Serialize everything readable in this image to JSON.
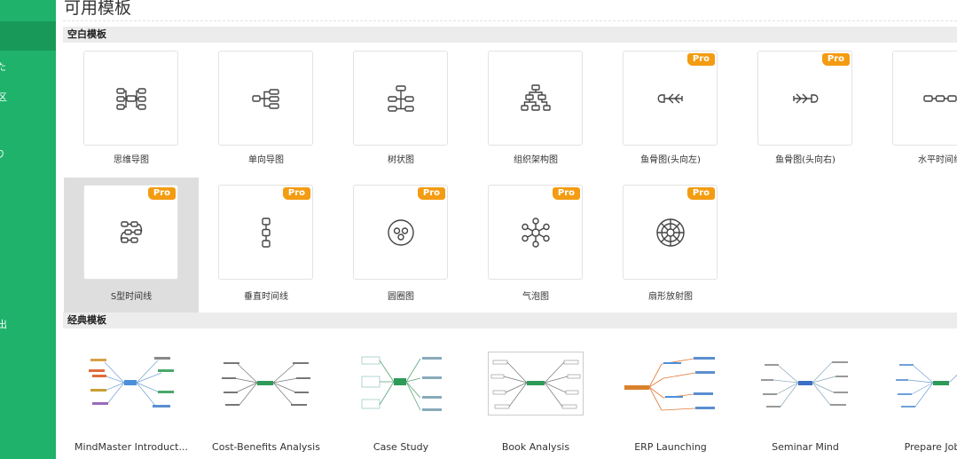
{
  "colors": {
    "sidebar": "#1fb26b",
    "sidebar_active": "#18995a",
    "pro_badge": "#f39c12",
    "selected_tile": "#dedede"
  },
  "sidebar": {
    "items": [
      "た",
      "区",
      "り",
      "出"
    ]
  },
  "page": {
    "title": "可用模板"
  },
  "sections": {
    "blank": "空白模板",
    "classic": "经典模板"
  },
  "pro_label": "Pro",
  "blank_templates": [
    {
      "label": "思维导图",
      "icon": "mind-map-icon",
      "pro": false
    },
    {
      "label": "单向导图",
      "icon": "right-map-icon",
      "pro": false
    },
    {
      "label": "树状图",
      "icon": "tree-map-icon",
      "pro": false
    },
    {
      "label": "组织架构图",
      "icon": "org-chart-icon",
      "pro": false
    },
    {
      "label": "鱼骨图(头向左)",
      "icon": "fishbone-left-icon",
      "pro": true
    },
    {
      "label": "鱼骨图(头向右)",
      "icon": "fishbone-right-icon",
      "pro": true
    },
    {
      "label": "水平时间线",
      "icon": "horizontal-timeline-icon",
      "pro": true
    },
    {
      "label": "S型时间线",
      "icon": "s-timeline-icon",
      "pro": true,
      "selected": true
    },
    {
      "label": "垂直时间线",
      "icon": "vertical-timeline-icon",
      "pro": true
    },
    {
      "label": "圆圈图",
      "icon": "circle-map-icon",
      "pro": true
    },
    {
      "label": "气泡图",
      "icon": "bubble-map-icon",
      "pro": true
    },
    {
      "label": "扇形放射图",
      "icon": "sector-radial-icon",
      "pro": true
    }
  ],
  "classic_templates": [
    {
      "label": "MindMaster Introduct..."
    },
    {
      "label": "Cost-Benefits Analysis"
    },
    {
      "label": "Case Study"
    },
    {
      "label": "Book Analysis"
    },
    {
      "label": "ERP Launching"
    },
    {
      "label": "Seminar Mind"
    },
    {
      "label": "Prepare Job Int"
    }
  ]
}
